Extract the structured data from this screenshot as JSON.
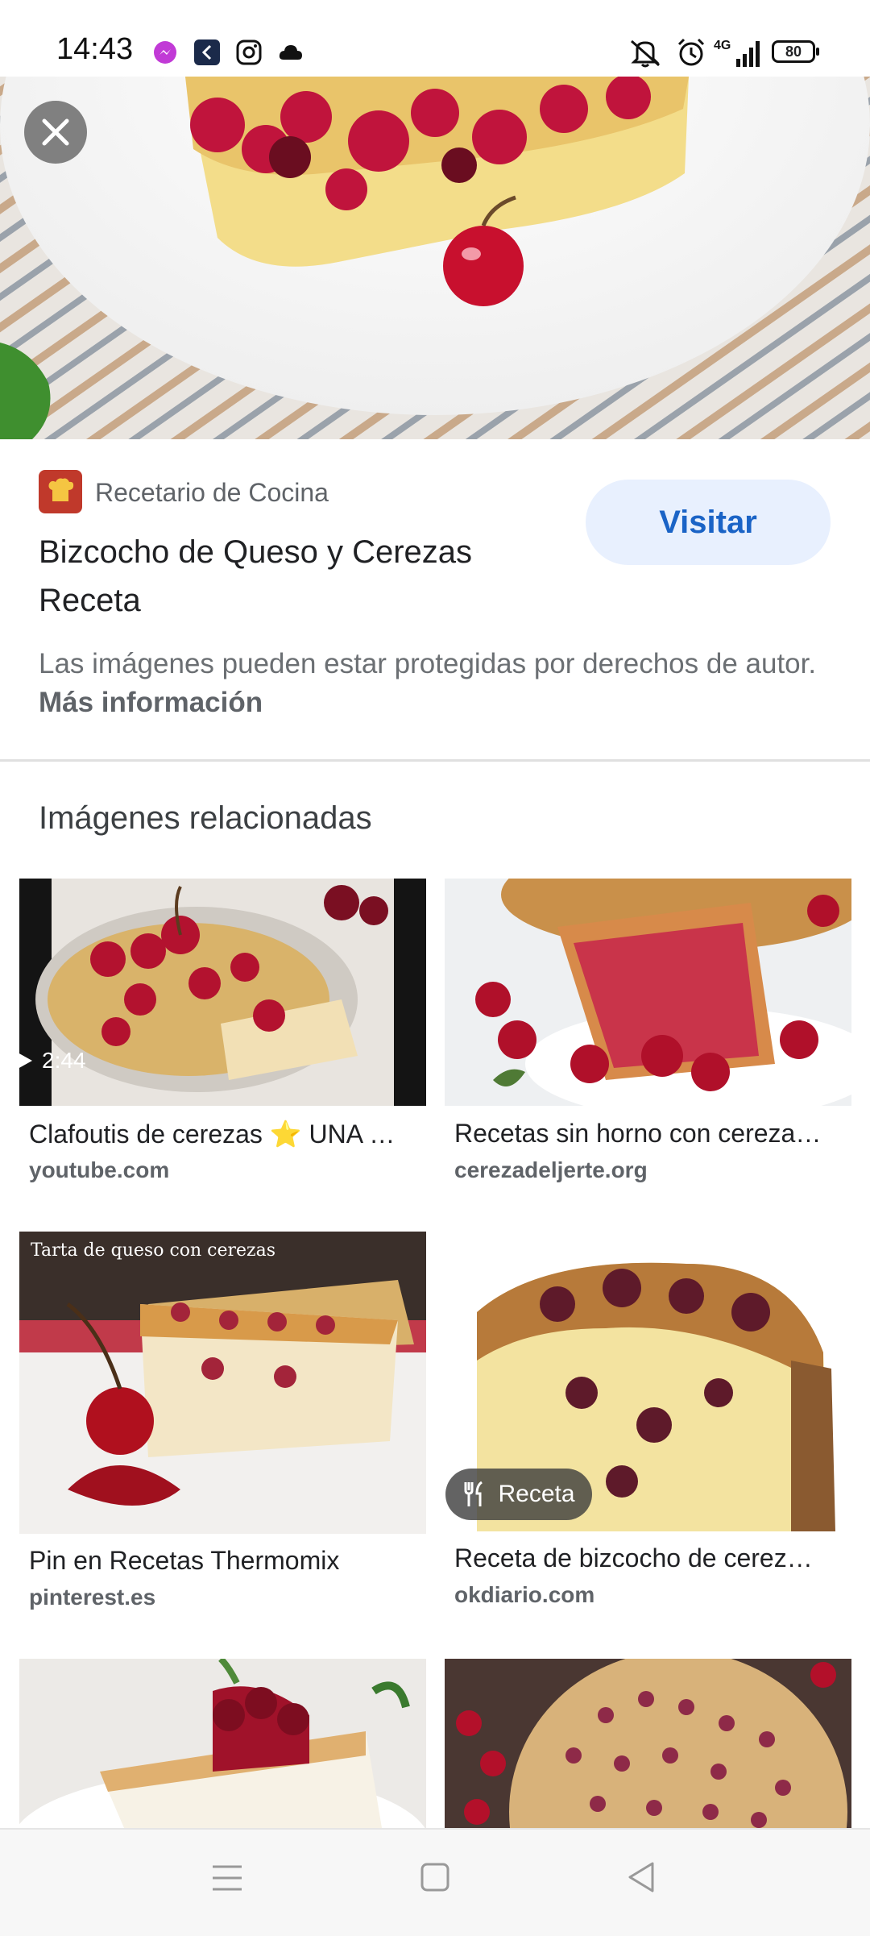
{
  "status_bar": {
    "time": "14:43",
    "battery": "80",
    "icons": [
      "messenger-icon",
      "app-k-icon",
      "instagram-icon",
      "cloud-icon",
      "mute-icon",
      "alarm-icon",
      "signal-4g-icon",
      "battery-icon"
    ]
  },
  "hero": {
    "image": "cherry-cheesecake-image",
    "close_icon": "close-icon"
  },
  "result": {
    "source": "Recetario de Cocina",
    "title": "Bizcocho de Queso y Cerezas Receta",
    "visit_label": "Visitar",
    "copyright_text": "Las imágenes pueden estar protegidas por derechos de autor.",
    "more_info_label": "Más información"
  },
  "related": {
    "heading": "Imágenes relacionadas",
    "items": [
      {
        "title": "Clafoutis de cerezas ⭐ UNA …",
        "source": "youtube.com",
        "duration": "2:44"
      },
      {
        "title": "Recetas sin horno con cereza…",
        "source": "cerezadeljerte.org"
      },
      {
        "title": "Pin en Recetas Thermomix",
        "source": "pinterest.es",
        "image_text": "Tarta de queso con cerezas"
      },
      {
        "title": "Receta de bizcocho de cerez…",
        "source": "okdiario.com",
        "badge": "Receta"
      }
    ]
  },
  "nav": {
    "icons": [
      "menu-icon",
      "home-square-icon",
      "back-triangle-icon"
    ]
  },
  "colors": {
    "accent": "#1a63c6",
    "visit_bg": "#e8f0fe",
    "secondary_text": "#5f6368"
  }
}
